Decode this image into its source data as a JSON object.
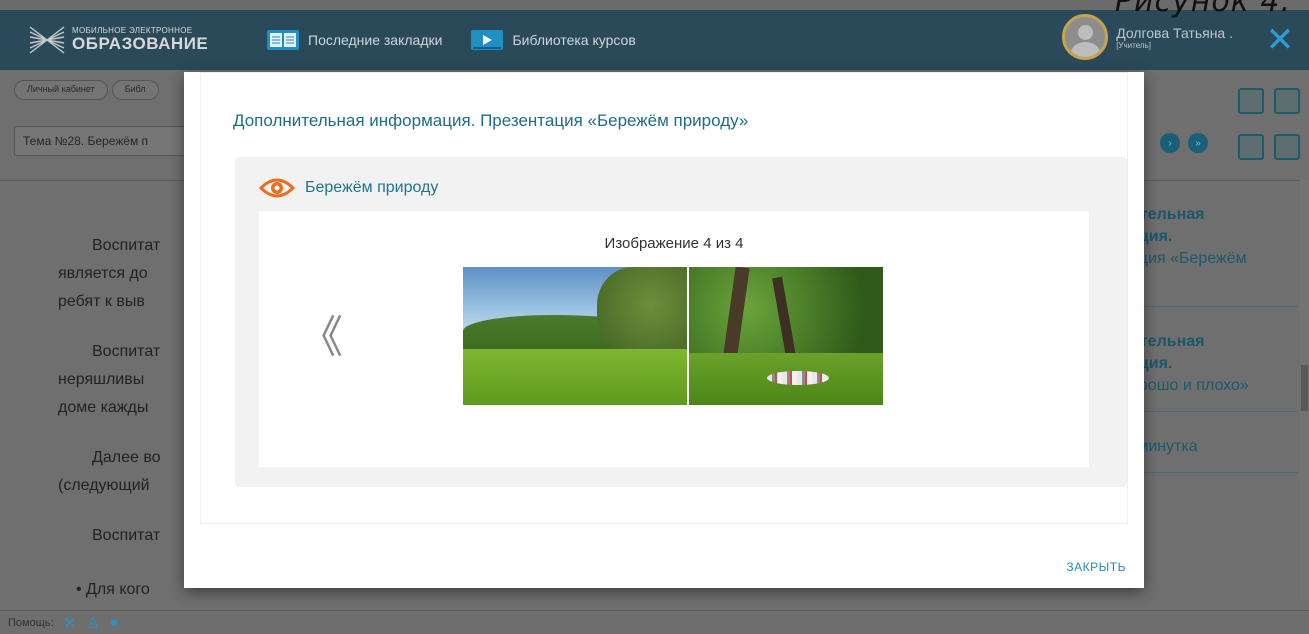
{
  "caption": "Рисунок 4.",
  "header": {
    "logo_small": "МОБИЛЬНОЕ ЭЛЕКТРОННОЕ",
    "logo_big": "ОБРАЗОВАНИЕ",
    "bookmarks_label": "Последние закладки",
    "library_label": "Библиотека курсов",
    "user_name": "Долгова Татьяна .",
    "user_role": "[Учитель]",
    "close_glyph": "✕"
  },
  "page": {
    "breadcrumbs": [
      "Личный кабинет",
      "Библ"
    ],
    "topic": "Тема №28. Бережём п",
    "lines": [
      "Воспитат",
      "является до",
      "ребят к выв",
      "Воспитат",
      "неряшливы",
      "доме кажды",
      "Далее во",
      "(следующий",
      "Воспитат",
      "• Для кого"
    ],
    "side": [
      {
        "bold": "ительная",
        "bold2": "ация.",
        "text": "ация «Бережём",
        "text2": "»"
      },
      {
        "bold": "ительная",
        "bold2": "ация.",
        "text": "орошо и плохо»",
        "text2": ""
      },
      {
        "bold": "",
        "bold2": "",
        "text": "тминутка",
        "text2": ""
      }
    ]
  },
  "footer": {
    "help_label": "Помощь:"
  },
  "modal": {
    "title": "Дополнительная информация. Презентация «Бережём природу»",
    "viewer_title": "Бережём природу",
    "counter": "Изображение 4 из 4",
    "prev_glyph": "《",
    "close_label": "ЗАКРЫТЬ"
  },
  "colors": {
    "header_bg": "#2a4a5a",
    "accent": "#1c6e85",
    "close_blue": "#1e88c7",
    "eye_orange": "#ef6c1a"
  }
}
